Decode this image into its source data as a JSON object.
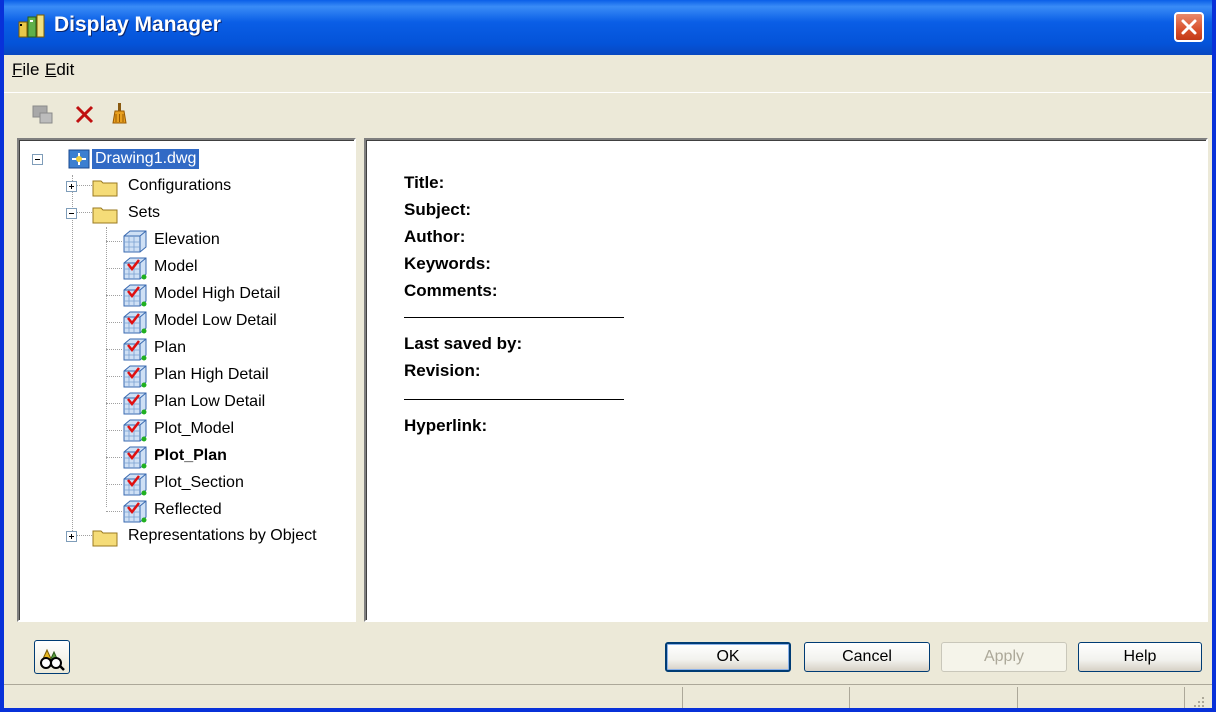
{
  "window": {
    "title": "Display Manager"
  },
  "menu": [
    {
      "accel": "F",
      "rest": "ile"
    },
    {
      "accel": "E",
      "rest": "dit"
    }
  ],
  "toolbar": {
    "buttons": [
      {
        "icon": "new-set-icon",
        "enabled": false
      },
      {
        "icon": "delete-icon",
        "enabled": true
      },
      {
        "icon": "purge-icon",
        "enabled": true
      }
    ]
  },
  "tree": {
    "root": "Drawing1.dwg",
    "configurations": "Configurations",
    "sets": "Sets",
    "set_items": [
      "Elevation",
      "Model",
      "Model High Detail",
      "Model Low Detail",
      "Plan",
      "Plan High Detail",
      "Plan Low Detail",
      "Plot_Model",
      "Plot_Plan",
      "Plot_Section",
      "Reflected"
    ],
    "representations": "Representations by Object"
  },
  "details": {
    "title_label": "Title:",
    "subject_label": "Subject:",
    "author_label": "Author:",
    "keywords_label": "Keywords:",
    "comments_label": "Comments:",
    "last_saved_label": "Last saved by:",
    "revision_label": "Revision:",
    "hyperlink_label": "Hyperlink:"
  },
  "buttons": {
    "ok": "OK",
    "cancel": "Cancel",
    "apply": "Apply",
    "help": "Help"
  },
  "colors": {
    "titlebar": "#0453d8",
    "selection": "#316ac5",
    "dialog_bg": "#ece9d8"
  }
}
